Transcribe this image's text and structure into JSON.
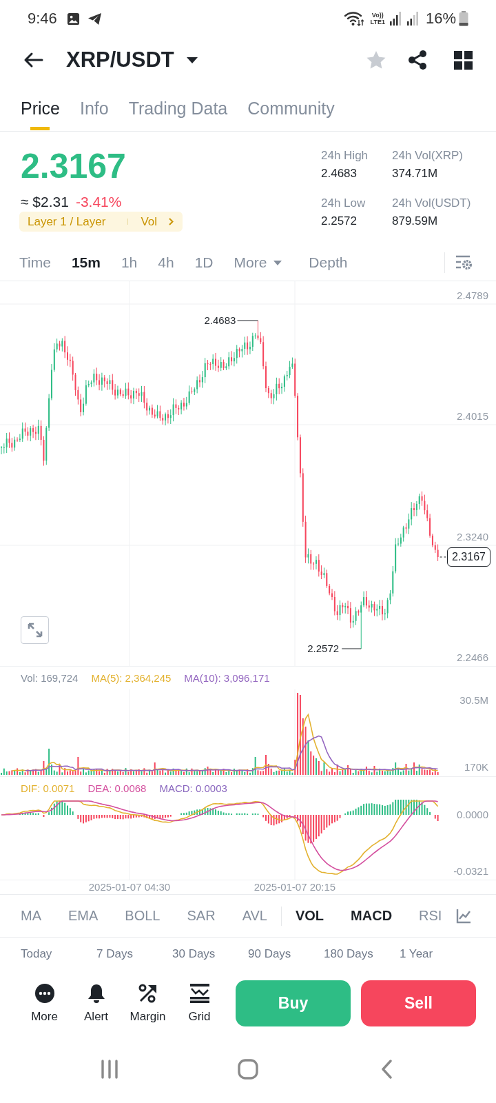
{
  "status_bar": {
    "time": "9:46",
    "network_labels": [
      "Vo))",
      "LTE1"
    ],
    "battery": "16%"
  },
  "header": {
    "title": "XRP/USDT",
    "favorite": false
  },
  "tabs": [
    {
      "label": "Price",
      "selected": true
    },
    {
      "label": "Info",
      "selected": false
    },
    {
      "label": "Trading Data",
      "selected": false
    },
    {
      "label": "Community",
      "selected": false
    }
  ],
  "quote": {
    "price": "2.3167",
    "price_up": true,
    "fiat": "≈ $2.31",
    "change": "-3.41%",
    "change_up": false,
    "tags": [
      "Layer 1 / Layer",
      "Vol"
    ]
  },
  "stats": [
    {
      "label": "24h High",
      "value": "2.4683"
    },
    {
      "label": "24h Vol(XRP)",
      "value": "374.71M"
    },
    {
      "label": "24h Low",
      "value": "2.2572"
    },
    {
      "label": "24h Vol(USDT)",
      "value": "879.59M"
    }
  ],
  "intervals": [
    {
      "label": "Time",
      "kind": "interval",
      "selected": false
    },
    {
      "label": "15m",
      "kind": "interval",
      "selected": true
    },
    {
      "label": "1h",
      "kind": "interval",
      "selected": false
    },
    {
      "label": "4h",
      "kind": "interval",
      "selected": false
    },
    {
      "label": "1D",
      "kind": "interval",
      "selected": false
    },
    {
      "label": "More",
      "kind": "dropdown",
      "selected": false
    },
    {
      "label": "Depth",
      "kind": "view",
      "selected": false
    }
  ],
  "price_chart": {
    "axis_labels": [
      "2.4789",
      "2.4015",
      "2.3240",
      "2.2466"
    ],
    "high_label": "2.4683",
    "low_label": "2.2572",
    "last_price": "2.3167"
  },
  "volume_chart": {
    "legend": [
      {
        "text": "Vol: 169,724",
        "color": "#848e9c"
      },
      {
        "text": "MA(5): 2,364,245",
        "color": "#e3b230"
      },
      {
        "text": "MA(10): 3,096,171",
        "color": "#9467c0"
      }
    ],
    "axis_labels": [
      "30.5M",
      "170K"
    ]
  },
  "macd_chart": {
    "legend": [
      {
        "text": "DIF: 0.0071",
        "color": "#e3b230"
      },
      {
        "text": "DEA: 0.0068",
        "color": "#d4509f"
      },
      {
        "text": "MACD: 0.0003",
        "color": "#8a67bf"
      }
    ],
    "axis_labels": [
      "0.0000",
      "-0.0321"
    ]
  },
  "time_labels": [
    "2025-01-07 04:30",
    "2025-01-07 20:15"
  ],
  "main_indicators": [
    {
      "label": "MA",
      "selected": false
    },
    {
      "label": "EMA",
      "selected": false
    },
    {
      "label": "BOLL",
      "selected": false
    },
    {
      "label": "SAR",
      "selected": false
    },
    {
      "label": "AVL",
      "selected": false
    }
  ],
  "sub_indicators": [
    {
      "label": "VOL",
      "selected": true
    },
    {
      "label": "MACD",
      "selected": true
    },
    {
      "label": "RSI",
      "selected": false
    }
  ],
  "ranges": [
    "Today",
    "7 Days",
    "30 Days",
    "90 Days",
    "180 Days",
    "1 Year"
  ],
  "actions": [
    {
      "label": "More",
      "kind": "more"
    },
    {
      "label": "Alert",
      "kind": "alert"
    },
    {
      "label": "Margin",
      "kind": "margin"
    },
    {
      "label": "Grid",
      "kind": "grid"
    }
  ],
  "trade_buttons": [
    {
      "label": "Buy",
      "kind": "buy"
    },
    {
      "label": "Sell",
      "kind": "sell"
    }
  ]
}
